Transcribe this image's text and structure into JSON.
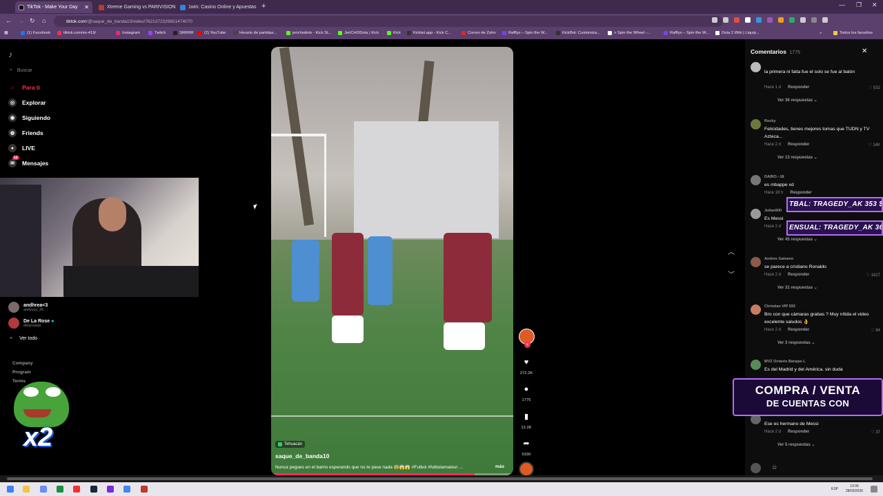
{
  "browser": {
    "tabs": [
      {
        "title": "TikTok - Make Your Day",
        "active": true,
        "color": "#111111"
      },
      {
        "title": "Xtreme Gaming vs PARIVISION",
        "active": false,
        "color": "#c0392b"
      },
      {
        "title": "1win: Casino Online y Apuestas",
        "active": false,
        "color": "#2e86de"
      }
    ],
    "url_host": "tiktok.com",
    "url_path": "/@saque_de_banda10/video/7621372329821474070",
    "bookmarks": [
      {
        "label": "(1) Facebook",
        "color": "#1877f2"
      },
      {
        "label": "tiktok.com/es-419/",
        "color": "#fe2c55"
      },
      {
        "label": "Instagram",
        "color": "#e1306c"
      },
      {
        "label": "Twitch",
        "color": "#9146ff"
      },
      {
        "label": "SRRRR",
        "color": "#222222"
      },
      {
        "label": "(2) YouTube",
        "color": "#ff0000"
      },
      {
        "label": "Horario de partidas...",
        "color": "#444444"
      },
      {
        "label": "jerichodoto - Kick St...",
        "color": "#53fc18"
      },
      {
        "label": "JeriCHODota | Kick",
        "color": "#53fc18"
      },
      {
        "label": "Kick",
        "color": "#53fc18"
      },
      {
        "label": "Kicklet.app - Kick C...",
        "color": "#333333"
      },
      {
        "label": "Correo de Zoho",
        "color": "#e42527"
      },
      {
        "label": "Rafflys – Spin the W...",
        "color": "#7b3ff2"
      },
      {
        "label": "KickBot: Customiza...",
        "color": "#333333"
      },
      {
        "label": "> Spin the Wheel -...",
        "color": "#ffffff"
      },
      {
        "label": "Rafflys – Spin the W...",
        "color": "#7b3ff2"
      },
      {
        "label": "Dota 2 Wiki | Liquip...",
        "color": "#ffffff"
      }
    ],
    "all_favorites": "Todos los favoritos"
  },
  "sidebar": {
    "search_placeholder": "Buscar",
    "items": [
      {
        "label": "Para ti",
        "color": "#fe2c55",
        "icon": "home-icon"
      },
      {
        "label": "Explorar",
        "color": "#ffffff",
        "icon": "compass-icon"
      },
      {
        "label": "Siguiendo",
        "color": "#ffffff",
        "icon": "following-icon"
      },
      {
        "label": "Friends",
        "color": "#ffffff",
        "icon": "friends-icon"
      },
      {
        "label": "LIVE",
        "color": "#ffffff",
        "icon": "live-icon"
      },
      {
        "label": "Mensajes",
        "color": "#ffffff",
        "icon": "messages-icon",
        "badge": "12"
      }
    ],
    "accounts": [
      {
        "name": "andhrea<3",
        "handle": "andyyyy_26"
      },
      {
        "name": "De La Rose",
        "handle": "delarosepr"
      }
    ],
    "see_all": "Ver todo",
    "footer": [
      "Company",
      "Program",
      "Terms"
    ]
  },
  "overlay": {
    "pepe_multiplier": "x2",
    "alert1": "TBAL: TRAGEDY_AK 353 $",
    "alert2": "ENSUAL: TRAGEDY_AK 36",
    "promo_line1": "COMPRA / VENTA",
    "promo_line2": "DE CUENTAS CON"
  },
  "video": {
    "location": "Tehuacán",
    "username": "saque_de_banda10",
    "description": "Nunca pegues en el barrio esperando que no te pase nada 😨😱😱 #Futbol #futbolamateur ...",
    "more": "más",
    "progress": 0.84,
    "likes": "272.2K",
    "comments": "1775",
    "saves": "12.2K",
    "shares": "5330"
  },
  "comments_panel": {
    "title": "Comentarios",
    "count": "1775",
    "reply_label": "Responder",
    "items": [
      {
        "user": "",
        "text": "la primera ni falta fue el solo se fue al balón",
        "time": "Hace 1 d",
        "likes": "532",
        "more": "Ver 36 respuestas"
      },
      {
        "user": "Rocky",
        "text": "Felicidades, tienes mejores tomas que TUDN y TV Azteca...",
        "time": "Hace 2 d",
        "likes": "14K",
        "more": "Ver 13 respuestas"
      },
      {
        "user": "DAIRO.~18",
        "text": "es mbappe xd",
        "time": "Hace 18 h",
        "likes": "",
        "more": ""
      },
      {
        "user": "Julian900",
        "text": "Es Messi",
        "time": "Hace 2 d",
        "likes": "",
        "more": "Ver 45 respuestas"
      },
      {
        "user": "Andres Galeano",
        "text": "se parece a cristiano Ronaldo",
        "time": "Hace 2 d",
        "likes": "1627",
        "more": "Ver 31 respuestas"
      },
      {
        "user": "Christian VIP 593",
        "text": "Bro con que cámaras grabas ? Muy nítida el video excelente saludos 👌",
        "time": "Hace 2 d",
        "likes": "84",
        "more": "Ver 3 respuestas"
      },
      {
        "user": "MVZ Octavio Barajas L",
        "text": "Es del Madrid y del América. sin duda",
        "time": "",
        "likes": "",
        "more": ""
      },
      {
        "user": "",
        "text": "Ese es hermano de Messi",
        "time": "Hace 2 d",
        "likes": "37",
        "more": "Ver 5 respuestas"
      }
    ]
  },
  "taskbar": {
    "lang": "ESP",
    "time": "13:05",
    "date": "28/03/2026"
  }
}
